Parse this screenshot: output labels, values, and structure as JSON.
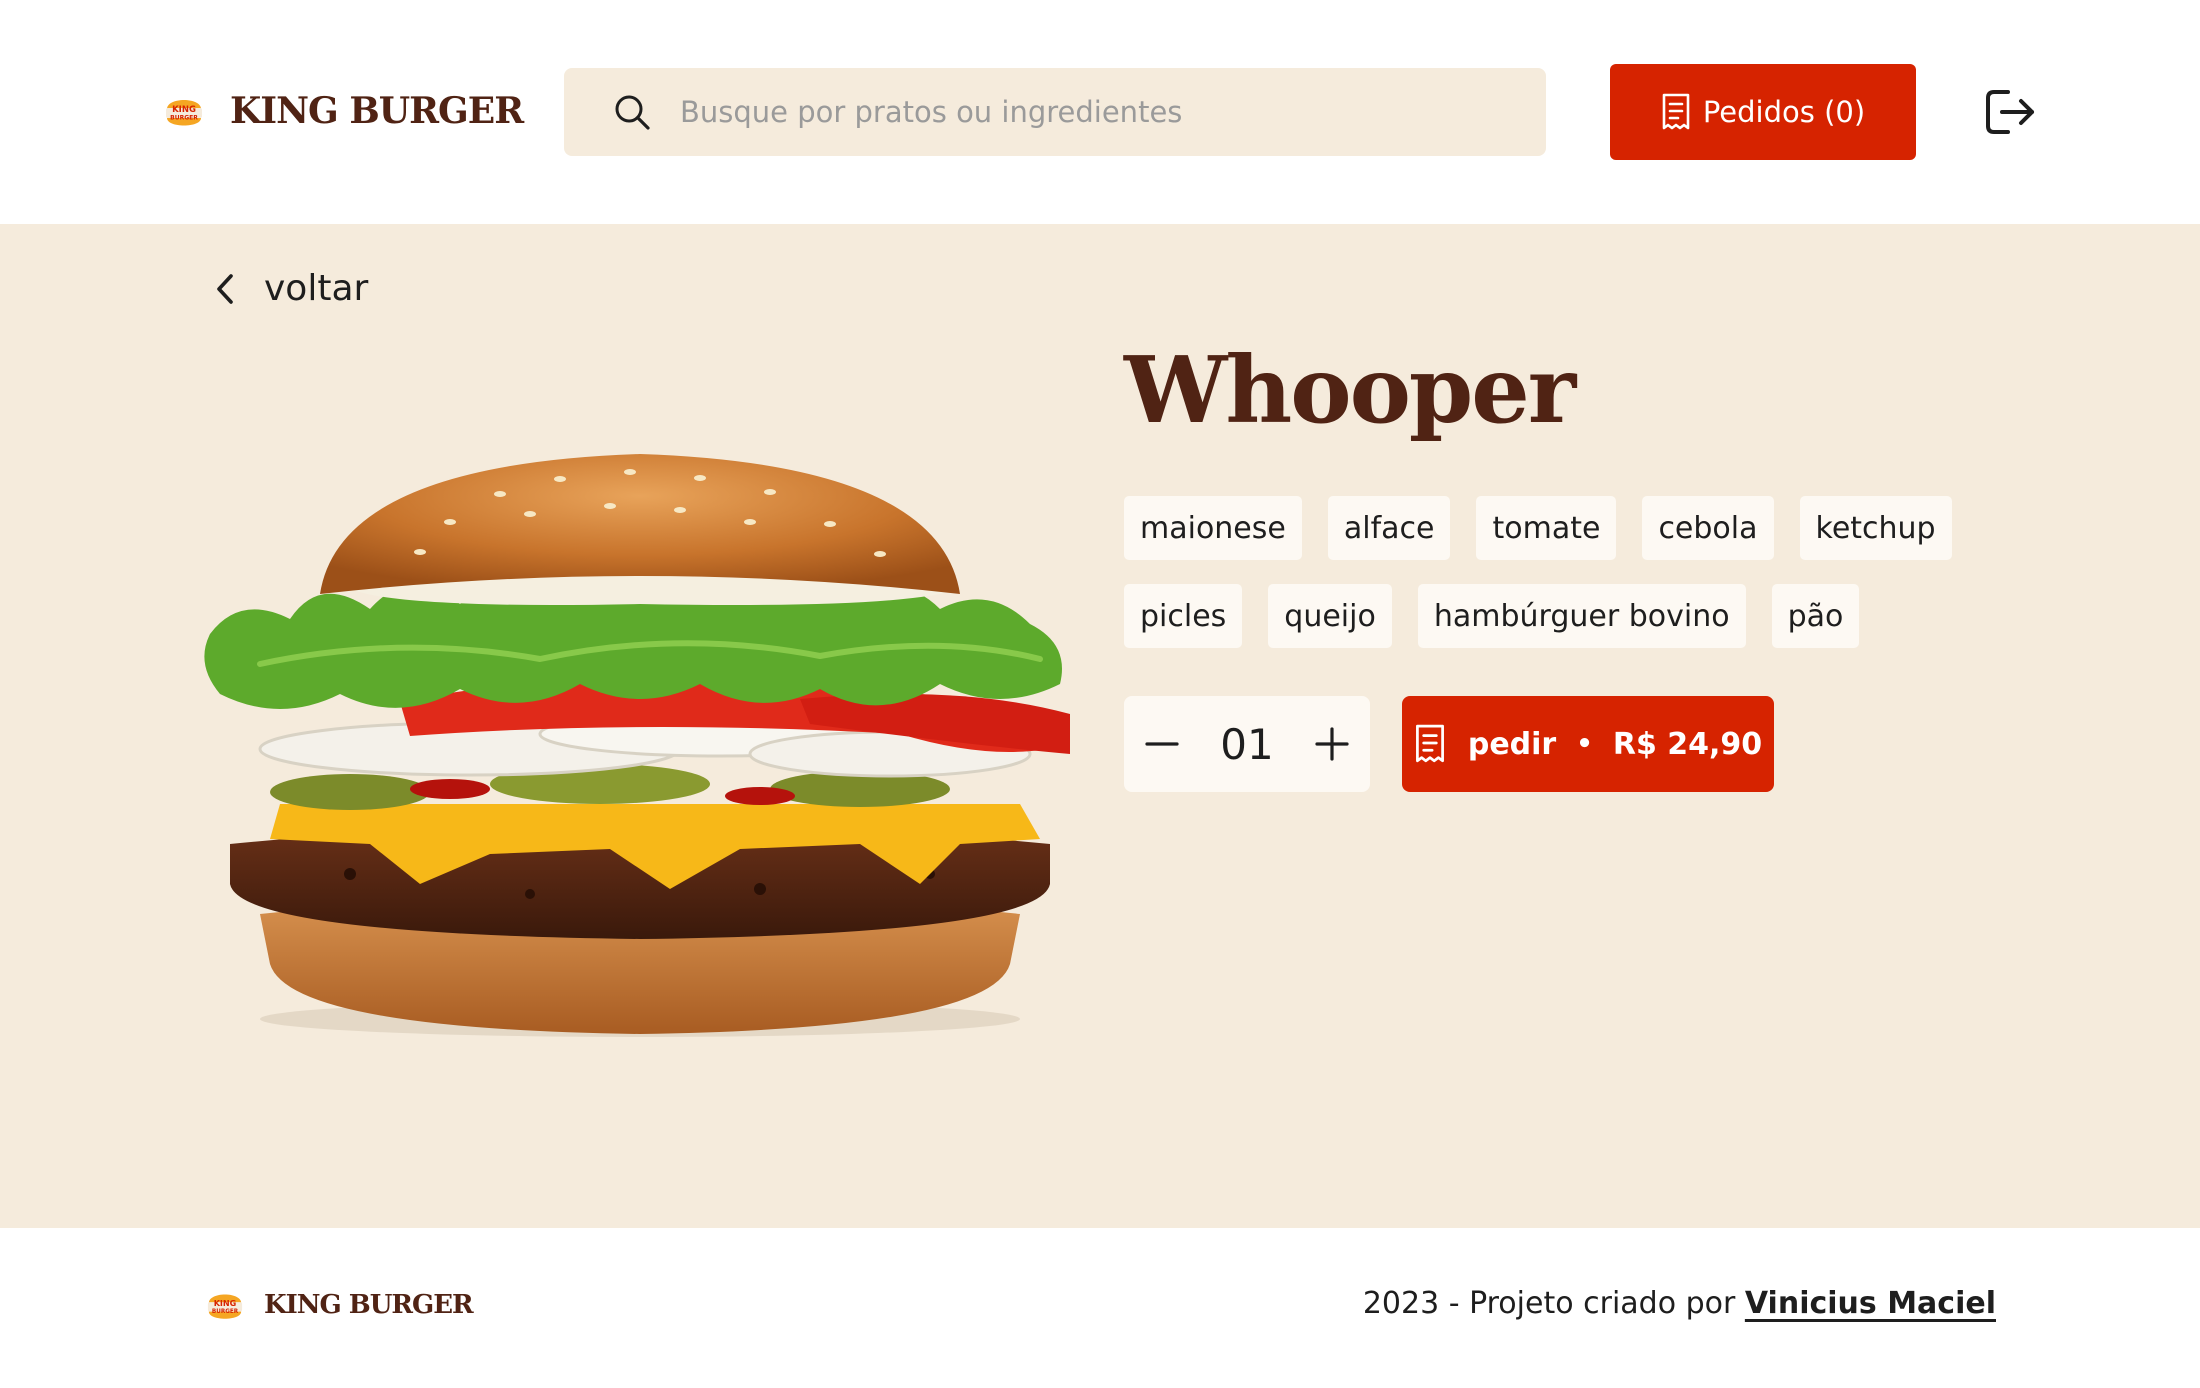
{
  "header": {
    "brand": {
      "logo_text_top": "KING",
      "logo_text_bottom": "BURGER",
      "name": "KING BURGER"
    },
    "search": {
      "icon": "search-icon",
      "placeholder": "Busque por pratos ou ingredientes",
      "value": ""
    },
    "orders_button": {
      "icon": "receipt-icon",
      "label": "Pedidos",
      "count": "(0)"
    },
    "logout": {
      "icon": "sign-out-icon"
    }
  },
  "main": {
    "back": {
      "icon": "chevron-left-icon",
      "label": "voltar"
    },
    "product": {
      "image_alt": "Whooper burger",
      "name": "Whooper",
      "ingredients": [
        "maionese",
        "alface",
        "tomate",
        "cebola",
        "ketchup",
        "picles",
        "queijo",
        "hambúrguer bovino",
        "pão"
      ],
      "quantity": "01",
      "order_button": {
        "icon": "receipt-icon",
        "label": "pedir",
        "separator": "•",
        "price": "R$ 24,90"
      }
    }
  },
  "footer": {
    "brand": {
      "logo_text_top": "KING",
      "logo_text_bottom": "BURGER",
      "name": "KING BURGER"
    },
    "credits_prefix": "2023 - Projeto criado por ",
    "author": "Vinicius Maciel"
  },
  "colors": {
    "accent": "#D62300",
    "brand_brown": "#502314",
    "cream": "#F5EBDC",
    "tag_bg": "#FDF9F3"
  }
}
